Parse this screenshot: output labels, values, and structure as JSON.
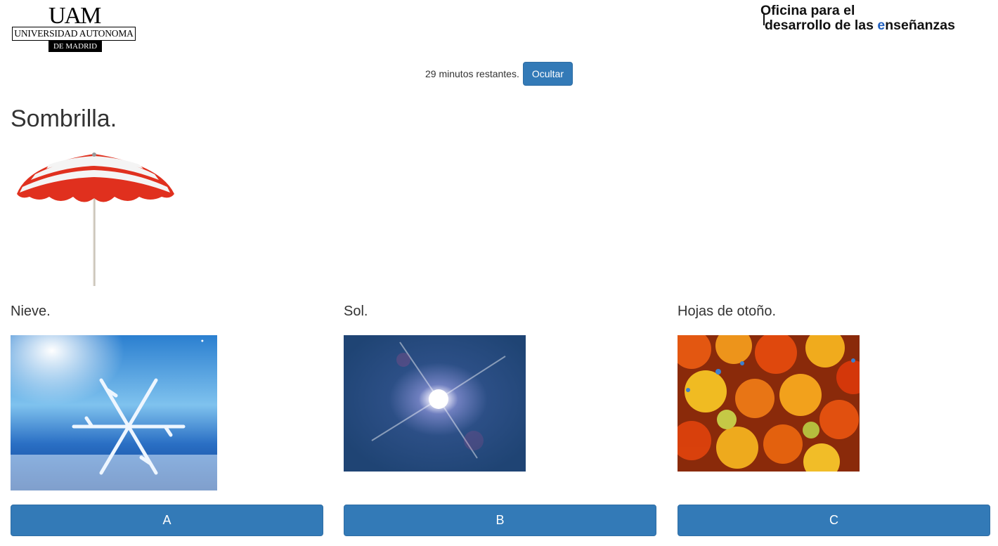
{
  "header": {
    "uam_logo": {
      "mark": "UAM",
      "name": "UNIVERSIDAD AUTONOMA",
      "city": "DE MADRID"
    },
    "ode_logo": {
      "line1": "Oficina para el",
      "line2_prefix": "desarrollo de las ",
      "line2_accent": "e",
      "line2_suffix": "nseñanzas"
    }
  },
  "timer": {
    "text": "29 minutos restantes.",
    "hide_label": "Ocultar"
  },
  "question": {
    "title": "Sombrilla.",
    "image_icon": "beach-umbrella"
  },
  "options": [
    {
      "label": "Nieve.",
      "image_icon": "snowflake-photo",
      "button": "A"
    },
    {
      "label": "Sol.",
      "image_icon": "sun-photo",
      "button": "B"
    },
    {
      "label": "Hojas de otoño.",
      "image_icon": "autumn-leaves-photo",
      "button": "C"
    }
  ],
  "colors": {
    "primary": "#337ab7",
    "primary_border": "#2e6da4",
    "text": "#333333",
    "ode_accent": "#1f5fbf"
  }
}
